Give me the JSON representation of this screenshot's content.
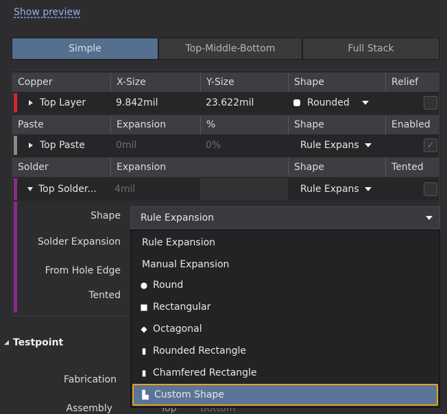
{
  "preview_link": "Show preview",
  "modes": {
    "simple": "Simple",
    "tmb": "Top-Middle-Bottom",
    "full": "Full Stack"
  },
  "copper": {
    "headers": [
      "Copper",
      "X-Size",
      "Y-Size",
      "Shape",
      "Relief"
    ],
    "layer": "Top Layer",
    "x": "9.842mil",
    "y": "23.622mil",
    "shape": "Rounded",
    "accent": "#d0282c"
  },
  "paste": {
    "headers": [
      "Paste",
      "Expansion",
      "%",
      "Shape",
      "Enabled"
    ],
    "layer": "Top Paste",
    "expansion": "0mil",
    "pct": "0%",
    "shape": "Rule Expans",
    "check": "✓"
  },
  "solder": {
    "headers": [
      "Solder",
      "Expansion",
      "Shape",
      "Tented"
    ],
    "layer": "Top Solder...",
    "expansion": "4mil",
    "shape": "Rule Expans",
    "accent": "#8a2b8a"
  },
  "details": {
    "shape_label": "Shape",
    "shape_value": "Rule Expansion",
    "solder_exp_label": "Solder Expansion",
    "hole_edge_label": "From Hole Edge",
    "tented_label": "Tented"
  },
  "menu": {
    "items": [
      {
        "label": "Rule Expansion",
        "icon": ""
      },
      {
        "label": "Manual Expansion",
        "icon": ""
      },
      {
        "label": "Round",
        "icon": "●"
      },
      {
        "label": "Rectangular",
        "icon": "■"
      },
      {
        "label": "Octagonal",
        "icon": "◆"
      },
      {
        "label": "Rounded Rectangle",
        "icon": "▮"
      },
      {
        "label": "Chamfered Rectangle",
        "icon": "▮"
      },
      {
        "label": "Custom Shape",
        "icon": "▙"
      }
    ]
  },
  "testpoint": {
    "title": "Testpoint",
    "fabrication": "Fabrication",
    "assembly": "Assembly",
    "top": "Top",
    "bottom": "Bottom"
  }
}
